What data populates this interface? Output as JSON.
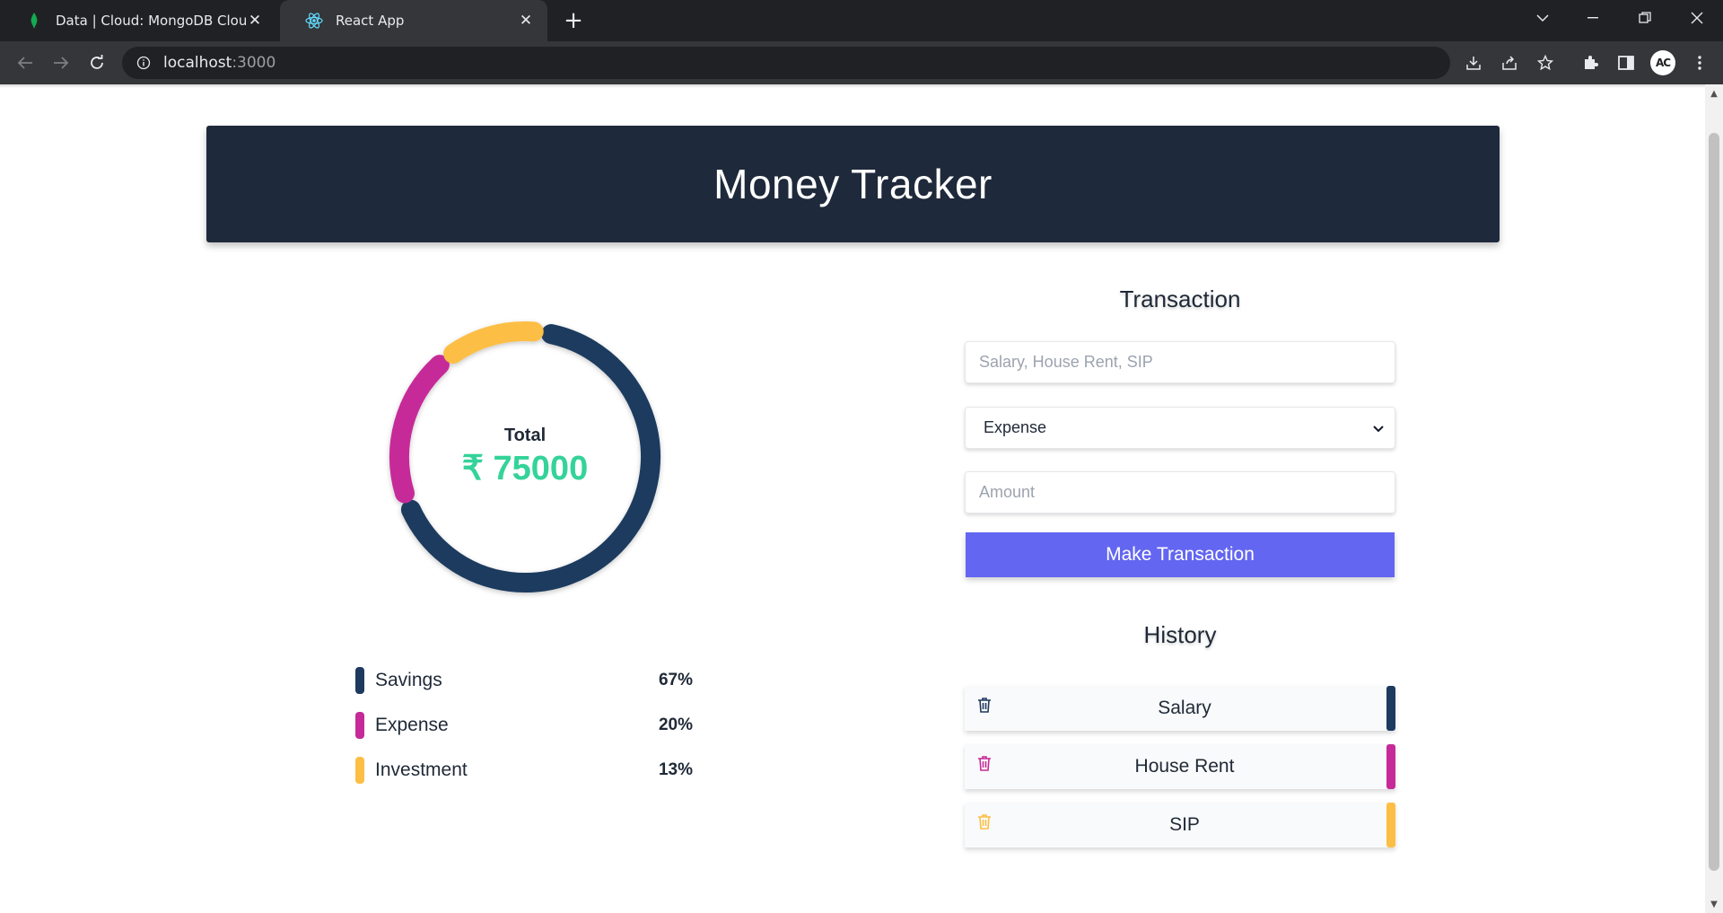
{
  "browser": {
    "tabs": [
      {
        "title": "Data | Cloud: MongoDB Cloud",
        "icon": "mongodb-leaf-icon"
      },
      {
        "title": "React App",
        "icon": "react-icon"
      }
    ],
    "url_host": "localhost",
    "url_port": ":3000",
    "avatar_initials": "AC"
  },
  "app": {
    "title": "Money Tracker",
    "total_label": "Total",
    "total_amount": "₹ 75000",
    "legend": [
      {
        "label": "Savings",
        "percent": "67%",
        "color": "#1e3a5f"
      },
      {
        "label": "Expense",
        "percent": "20%",
        "color": "#c62a98"
      },
      {
        "label": "Investment",
        "percent": "13%",
        "color": "#fcbe44"
      }
    ],
    "transaction": {
      "title": "Transaction",
      "name_placeholder": "Salary, House Rent, SIP",
      "type_selected": "Expense",
      "amount_placeholder": "Amount",
      "submit_label": "Make Transaction"
    },
    "history": {
      "title": "History",
      "items": [
        {
          "label": "Salary",
          "color": "#1e3a5f"
        },
        {
          "label": "House Rent",
          "color": "#c62a98"
        },
        {
          "label": "SIP",
          "color": "#fcbe44"
        }
      ]
    }
  },
  "chart_data": {
    "type": "pie",
    "categories": [
      "Savings",
      "Expense",
      "Investment"
    ],
    "values": [
      67,
      20,
      13
    ],
    "colors": [
      "#1e3a5f",
      "#c62a98",
      "#fcbe44"
    ],
    "title": ""
  }
}
